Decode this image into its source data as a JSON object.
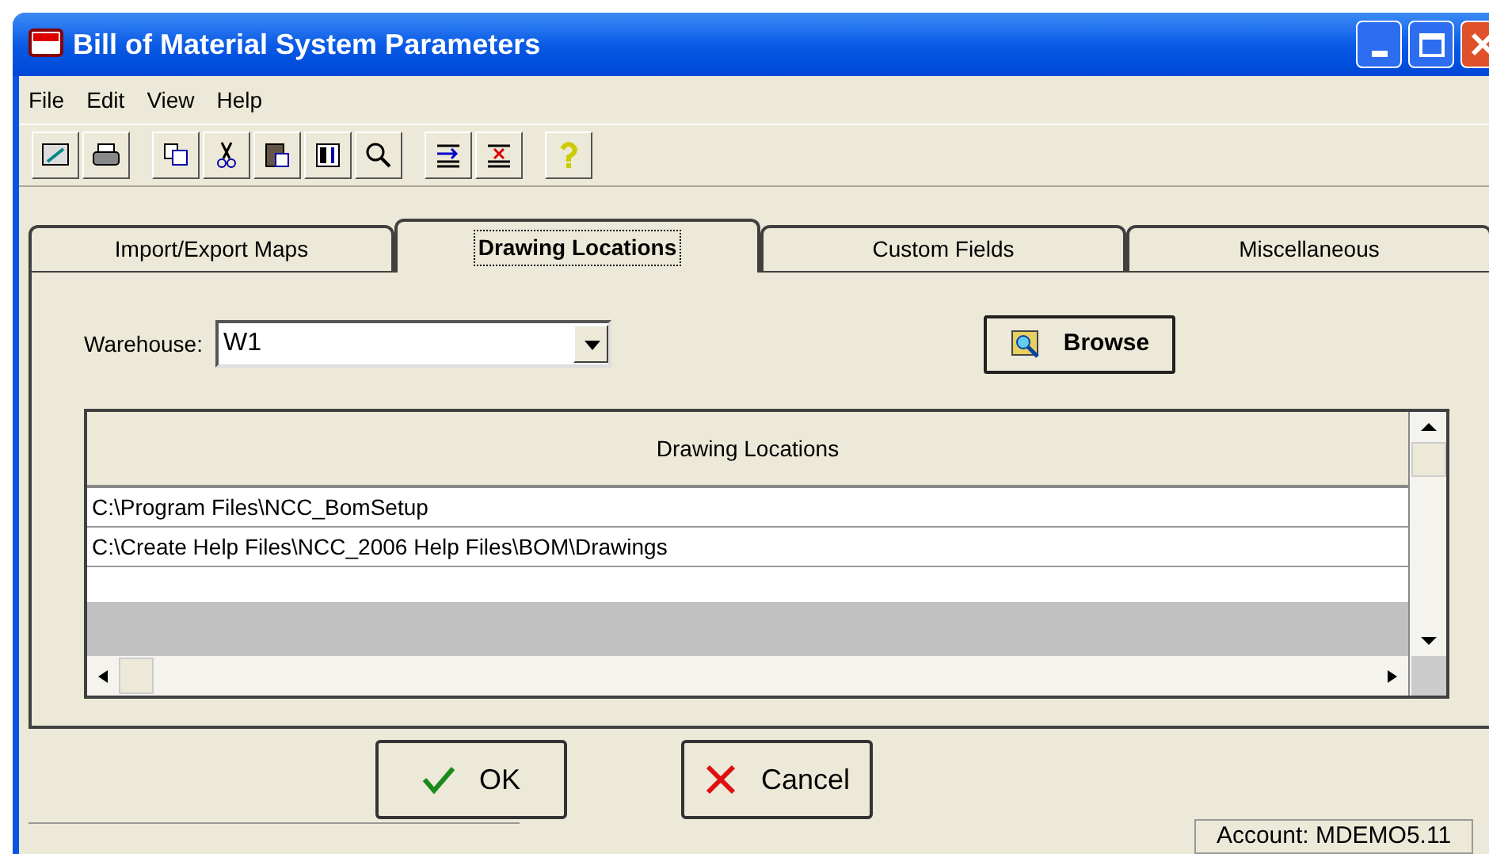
{
  "window": {
    "title": "Bill of Material System Parameters"
  },
  "menu": [
    "File",
    "Edit",
    "View",
    "Help"
  ],
  "tabs": [
    {
      "label": "Import/Export Maps",
      "selected": false
    },
    {
      "label": "Drawing Locations",
      "selected": true
    },
    {
      "label": "Custom Fields",
      "selected": false
    },
    {
      "label": "Miscellaneous",
      "selected": false
    }
  ],
  "warehouse": {
    "label": "Warehouse:",
    "value": "W1"
  },
  "browse_button": "Browse",
  "table": {
    "columns": [
      "Drawing Locations"
    ],
    "rows": [
      "C:\\Program Files\\NCC_BomSetup",
      "C:\\Create Help Files\\NCC_2006 Help Files\\BOM\\Drawings"
    ]
  },
  "buttons": [
    {
      "kind": "ok",
      "label": "OK"
    },
    {
      "kind": "cancel",
      "label": "Cancel"
    }
  ],
  "status_bar": {
    "account": "Account: MDEMO5.11"
  }
}
